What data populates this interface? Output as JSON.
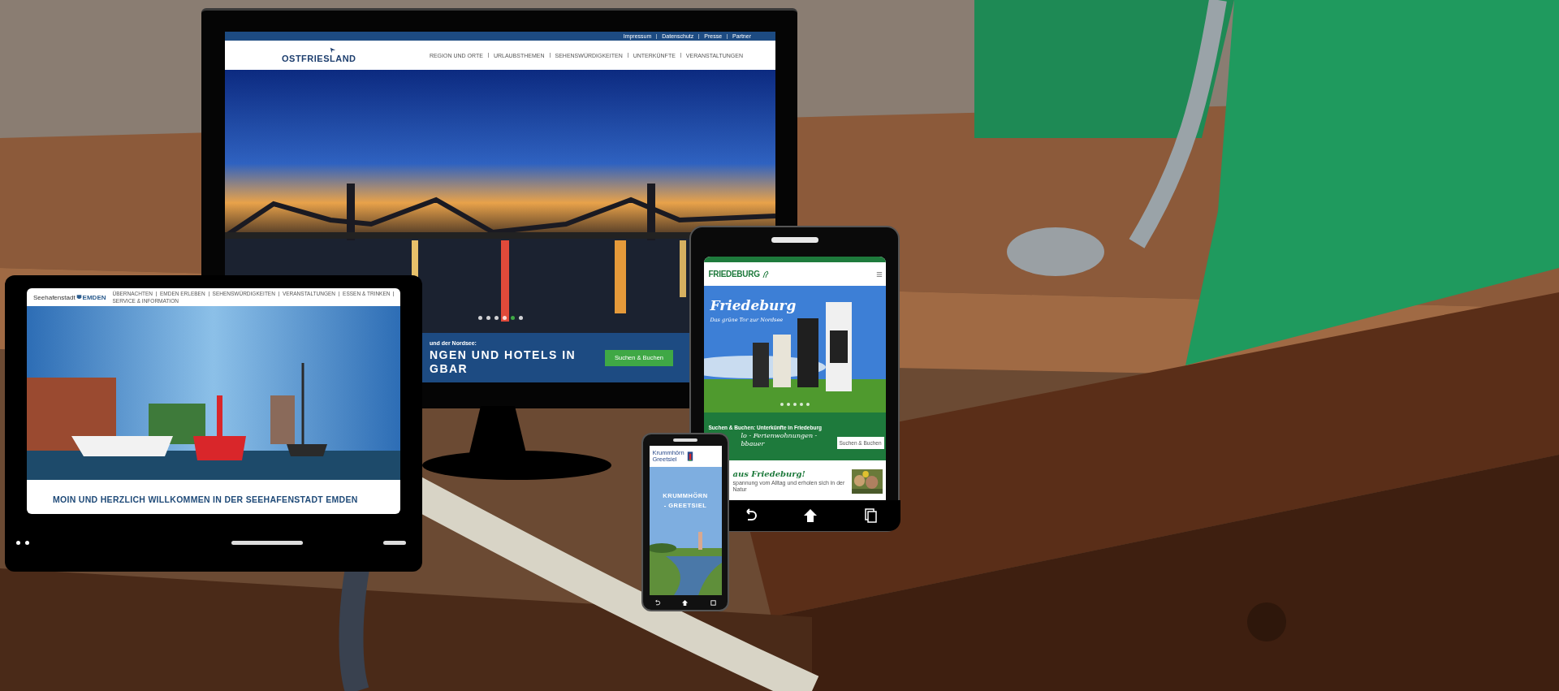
{
  "monitor": {
    "site": {
      "top_links": [
        "Impressum",
        "Datenschutz",
        "Presse",
        "Partner"
      ],
      "logo": "OSTFRIESLAND",
      "nav": [
        "REGION UND ORTE",
        "URLAUBSTHEMEN",
        "SEHENSWÜRDIGKEITEN",
        "UNTERKÜNFTE",
        "VERANSTALTUNGEN"
      ],
      "carousel_dots": [
        {
          "selected": false
        },
        {
          "selected": false
        },
        {
          "selected": false
        },
        {
          "selected": false
        },
        {
          "selected": true
        },
        {
          "selected": false
        }
      ],
      "intro": "und der Nordsee:",
      "headline": [
        "NGEN UND HOTELS IN",
        "GBAR"
      ],
      "button": "Suchen & Buchen"
    }
  },
  "laptop": {
    "site": {
      "logo": "Seehafenstadt",
      "logo_bold": "EMDEN",
      "nav": [
        "ÜBERNACHTEN",
        "EMDEN ERLEBEN",
        "SEHENSWÜRDIGKEITEN",
        "VERANSTALTUNGEN",
        "ESSEN & TRINKEN",
        "SERVICE & INFORMATION"
      ],
      "headline": "MOIN UND HERZLICH WILLKOMMEN IN DER SEEHAFENSTADT EMDEN"
    }
  },
  "tablet": {
    "site": {
      "logo": "FRIEDEBURG",
      "hero_title": "Friedeburg",
      "hero_subtitle": "Das grüne Tor zur Nordsee",
      "carousel_dots": [
        {
          "selected": false
        },
        {
          "selected": false
        },
        {
          "selected": false
        },
        {
          "selected": false
        },
        {
          "selected": false
        }
      ],
      "search_label": "Suchen & Buchen: Unterkünfte in Friedeburg",
      "search_headline": [
        "lo - Ferienwohnungen -",
        "bbauer"
      ],
      "button": "Suchen & Buchen",
      "greeting": "aus Friedeburg!",
      "teaser": "spannung vom Alltag und erholen sich in der Natur"
    }
  },
  "phone": {
    "site": {
      "logo": [
        "Krummhörn",
        "Greetsiel"
      ],
      "hero_title": "KRUMMHÖRN - GREETSIEL"
    }
  }
}
